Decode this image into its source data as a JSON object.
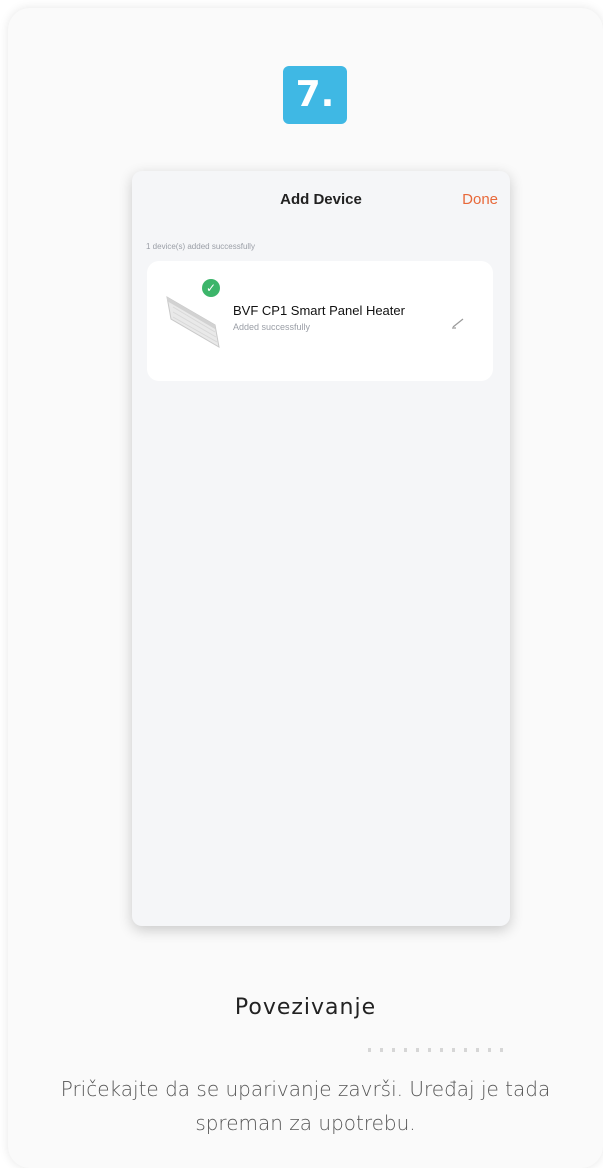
{
  "step": {
    "number": "7."
  },
  "app": {
    "title": "Add Device",
    "done_label": "Done",
    "added_count_text": "1 device(s) added successfully"
  },
  "device": {
    "name": "BVF CP1 Smart Panel Heater",
    "status": "Added successfully"
  },
  "caption": {
    "title": "Povezivanje",
    "description": "Pričekajte da se uparivanje završi. Uređaj je tada spreman za upotrebu."
  },
  "colors": {
    "badge": "#3fb8e4",
    "done": "#e8693a",
    "success": "#3cb56a"
  },
  "icons": [
    "heater-icon",
    "check-icon",
    "edit-pencil-icon"
  ]
}
